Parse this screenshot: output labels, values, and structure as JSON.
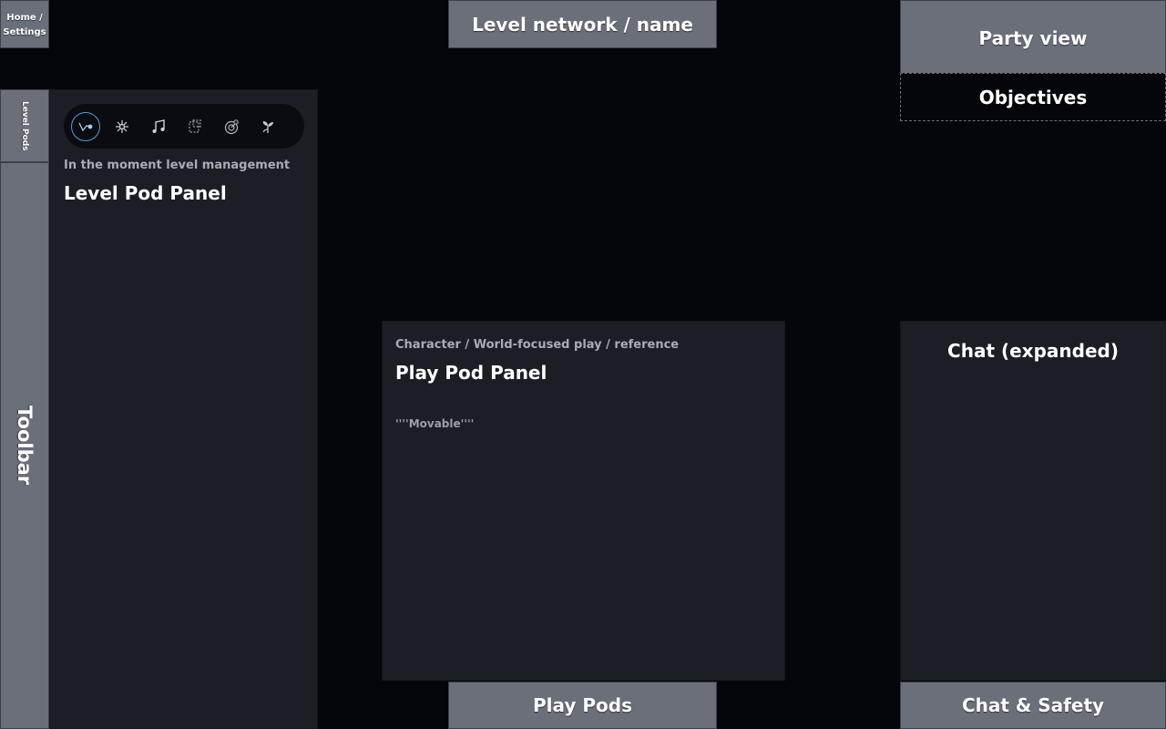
{
  "home": {
    "label": "Home / Settings"
  },
  "level_pods_tab": {
    "label": "Level Pods"
  },
  "toolbar": {
    "label": "Toolbar"
  },
  "level_network": {
    "label": "Level network / name"
  },
  "party_view": {
    "label": "Party view"
  },
  "objectives": {
    "label": "Objectives"
  },
  "level_pod_panel": {
    "subtitle": "In the moment level management",
    "title": "Level Pod Panel",
    "icons": [
      "graph-icon",
      "sparkle-icon",
      "music-note-icon",
      "dashed-square-icon",
      "radar-icon",
      "sprout-icon"
    ]
  },
  "play_pod_panel": {
    "subtitle": "Character / World-focused play / reference",
    "title": "Play Pod Panel",
    "note": "''''Movable''''"
  },
  "chat_panel": {
    "title": "Chat (expanded)"
  },
  "play_pods": {
    "label": "Play Pods"
  },
  "chat_safety": {
    "label": "Chat & Safety"
  },
  "colors": {
    "background": "#05060b",
    "panel": "#1b1e24",
    "tab_gray": "#6b6f7a",
    "accent": "#4ea0d8"
  }
}
